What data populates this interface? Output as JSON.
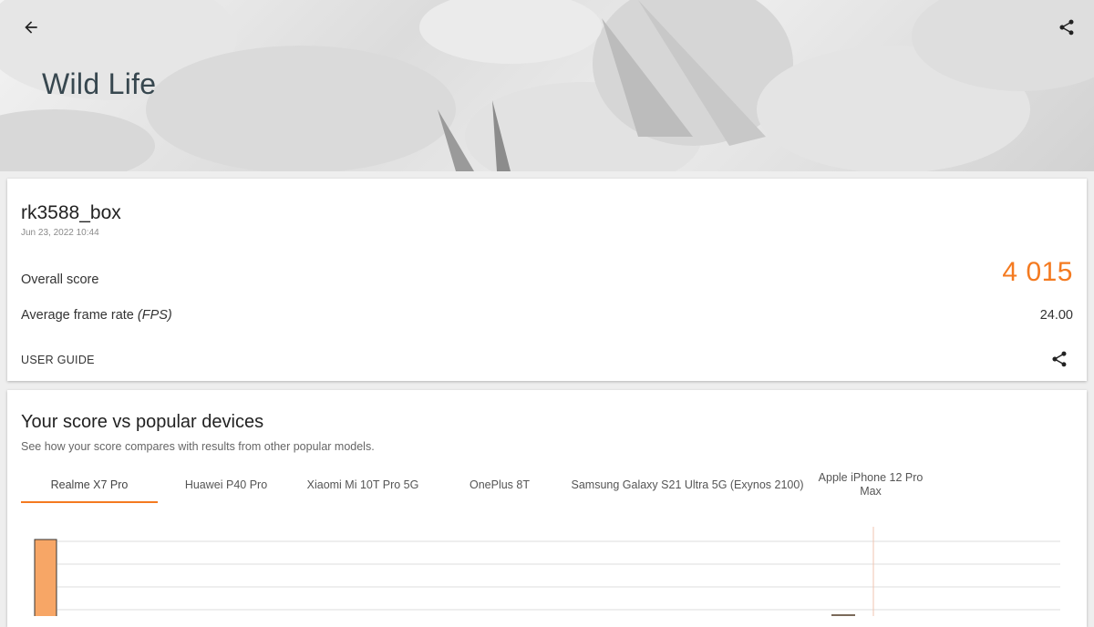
{
  "header": {
    "title": "Wild Life",
    "back_icon": "arrow-left-icon",
    "share_icon": "share-icon"
  },
  "result": {
    "device": "rk3588_box",
    "date": "Jun 23, 2022 10:44",
    "overall_label": "Overall score",
    "overall_value": "4 015",
    "fps_label": "Average frame rate",
    "fps_unit": "(FPS)",
    "fps_value": "24.00",
    "user_guide": "USER GUIDE",
    "accent_color": "#f47a20"
  },
  "comparison": {
    "title": "Your score vs popular devices",
    "subtitle": "See how your score compares with results from other popular models.",
    "tabs": [
      {
        "label": "Realme X7 Pro",
        "active": true
      },
      {
        "label": "Huawei P40 Pro",
        "active": false
      },
      {
        "label": "Xiaomi Mi 10T Pro 5G",
        "active": false
      },
      {
        "label": "OnePlus 8T",
        "active": false
      },
      {
        "label": "Samsung Galaxy S21 Ultra 5G (Exynos 2100)",
        "active": false
      },
      {
        "label": "Apple iPhone 12 Pro Max",
        "active": false
      }
    ]
  }
}
